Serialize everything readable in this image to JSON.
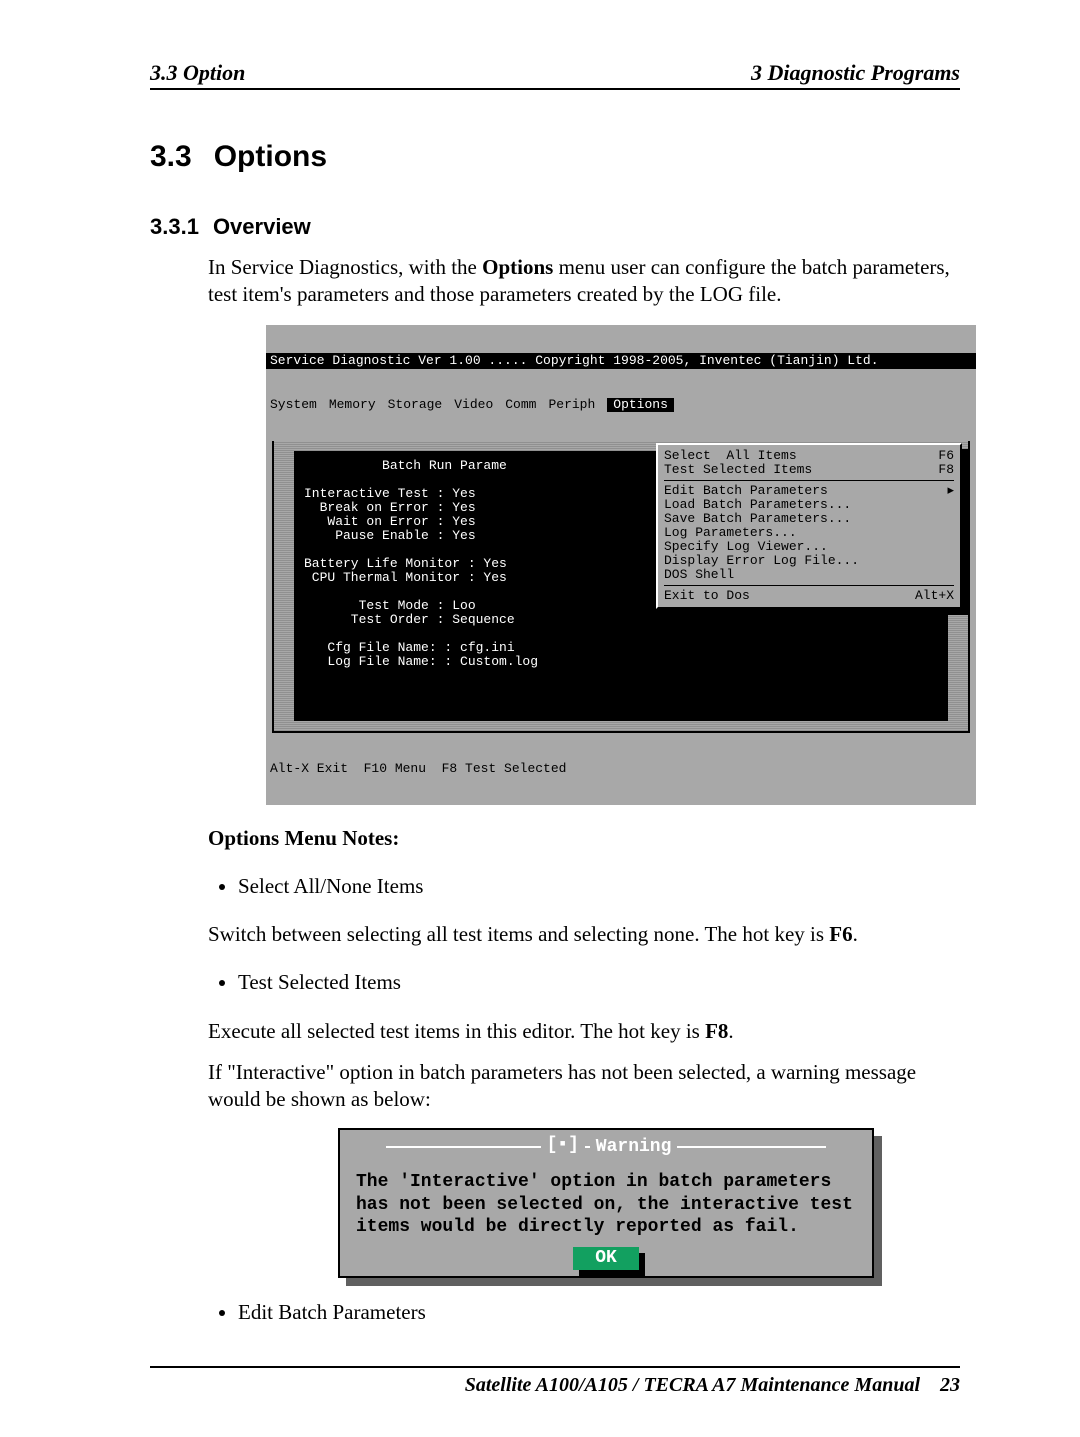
{
  "running_head": {
    "left": "3.3 Option",
    "right": "3  Diagnostic Programs"
  },
  "section": {
    "number": "3.3",
    "title": "Options"
  },
  "subsection": {
    "number": "3.3.1",
    "title": "Overview"
  },
  "intro": {
    "pre": "In Service Diagnostics, with the ",
    "bold": "Options",
    "post": " menu user can configure the batch parameters, test item's parameters and those parameters created by the LOG file."
  },
  "dos": {
    "title": "Service Diagnostic Ver 1.00 ..... Copyright 1998-2005, Inventec (Tianjin) Ltd.",
    "menus": [
      "System",
      "Memory",
      "Storage",
      "Video",
      "Comm",
      "Periph",
      "Options"
    ],
    "panel_lines": [
      "          Batch Run Parame",
      "",
      "Interactive Test : Yes",
      "  Break on Error : Yes",
      "   Wait on Error : Yes",
      "    Pause Enable : Yes",
      "",
      "Battery Life Monitor : Yes",
      " CPU Thermal Monitor : Yes",
      "",
      "       Test Mode : Loo",
      "      Test Order : Sequence",
      "",
      "   Cfg File Name: : cfg.ini",
      "   Log File Name: : Custom.log"
    ],
    "dropdown": [
      {
        "label": "Select  All Items",
        "hot": "F6"
      },
      {
        "label": "Test Selected Items",
        "hot": "F8"
      },
      {
        "sep": true
      },
      {
        "label": "Edit Batch Parameters",
        "hot": "▸"
      },
      {
        "label": "Load Batch Parameters...",
        "hot": ""
      },
      {
        "label": "Save Batch Parameters...",
        "hot": ""
      },
      {
        "label": "Log Parameters...",
        "hot": ""
      },
      {
        "label": "Specify Log Viewer...",
        "hot": ""
      },
      {
        "label": "Display Error Log File...",
        "hot": ""
      },
      {
        "label": "DOS Shell",
        "hot": ""
      },
      {
        "sep": true
      },
      {
        "label": "Exit to Dos",
        "hot": "Alt+X"
      }
    ],
    "status": "Alt-X Exit  F10 Menu  F8 Test Selected"
  },
  "notes_heading": "Options Menu Notes:",
  "bullet1": "Select All/None Items",
  "para1": {
    "pre": "Switch between selecting all test items and selecting none. The hot key is ",
    "bold": "F6",
    "post": "."
  },
  "bullet2": "Test Selected Items",
  "para2": {
    "pre": "Execute all selected test items in this editor. The hot key is ",
    "bold": "F8",
    "post": "."
  },
  "para3": "If  \"Interactive\" option in batch parameters has not been selected, a warning message would be shown as below:",
  "dialog": {
    "title": "Warning",
    "body": "The 'Interactive' option in batch parameters has not been selected on, the interactive test items would be directly reported as fail.",
    "ok": "OK"
  },
  "bullet3": "Edit Batch Parameters",
  "footer": {
    "title": "Satellite A100/A105 / TECRA A7 Maintenance Manual",
    "page": "23"
  }
}
